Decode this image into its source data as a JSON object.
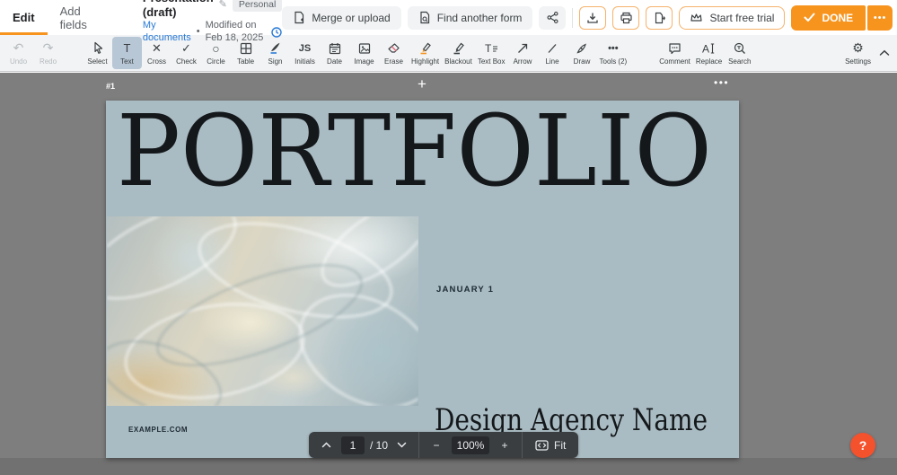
{
  "colors": {
    "accent_orange": "#F7941E",
    "help_orange": "#F4512D",
    "link_blue": "#2B7BD6",
    "slide_bg": "#AABCC3",
    "canvas_bg": "#7E7E7E",
    "toolbar_bg": "#F1F3F4",
    "pagenav_bg": "#3B3E41",
    "active_tool_bg": "#B7C7D6"
  },
  "header": {
    "tabs": [
      {
        "label": "Edit",
        "active": true
      },
      {
        "label": "Add fields",
        "active": false
      }
    ],
    "doc": {
      "title": "Presentation (draft)",
      "badge": "Personal",
      "breadcrumb": "My documents",
      "separator": "•",
      "modified": "Modified on Feb 18, 2025"
    },
    "actions": {
      "merge": "Merge or upload",
      "find": "Find another form",
      "trial": "Start free trial",
      "done": "DONE",
      "more": "•••"
    }
  },
  "toolbar": {
    "items": [
      {
        "label": "Undo",
        "state": "disabled"
      },
      {
        "label": "Redo",
        "state": "disabled"
      },
      {
        "label": "Select",
        "state": "normal"
      },
      {
        "label": "Text",
        "state": "active",
        "glyph": "T"
      },
      {
        "label": "Cross",
        "state": "normal",
        "glyph": "✕"
      },
      {
        "label": "Check",
        "state": "normal",
        "glyph": "✓"
      },
      {
        "label": "Circle",
        "state": "normal",
        "glyph": "○"
      },
      {
        "label": "Table",
        "state": "normal"
      },
      {
        "label": "Sign",
        "state": "normal"
      },
      {
        "label": "Initials",
        "state": "normal",
        "glyph": "JS"
      },
      {
        "label": "Date",
        "state": "normal"
      },
      {
        "label": "Image",
        "state": "normal"
      },
      {
        "label": "Erase",
        "state": "normal"
      },
      {
        "label": "Highlight",
        "state": "normal"
      },
      {
        "label": "Blackout",
        "state": "normal"
      },
      {
        "label": "Text Box",
        "state": "normal"
      },
      {
        "label": "Arrow",
        "state": "normal"
      },
      {
        "label": "Line",
        "state": "normal"
      },
      {
        "label": "Draw",
        "state": "normal"
      },
      {
        "label": "Tools (2)",
        "state": "normal",
        "glyph": "•••"
      },
      {
        "label": "Comment",
        "state": "normal"
      },
      {
        "label": "Replace",
        "state": "normal"
      },
      {
        "label": "Search",
        "state": "normal"
      },
      {
        "label": "Settings",
        "state": "normal",
        "glyph": "⚙"
      }
    ]
  },
  "canvas": {
    "page_label": "#1",
    "add_page": "+",
    "page_more": "•••",
    "slide": {
      "title": "PORTFOLIO",
      "date": "JANUARY 1",
      "agency": "Design Agency Name",
      "site": "EXAMPLE.COM"
    }
  },
  "pagenav": {
    "page": "1",
    "total": "/ 10",
    "zoom_out": "−",
    "zoom_level": "100%",
    "zoom_in": "+",
    "fit": "Fit"
  },
  "help": {
    "label": "?"
  }
}
